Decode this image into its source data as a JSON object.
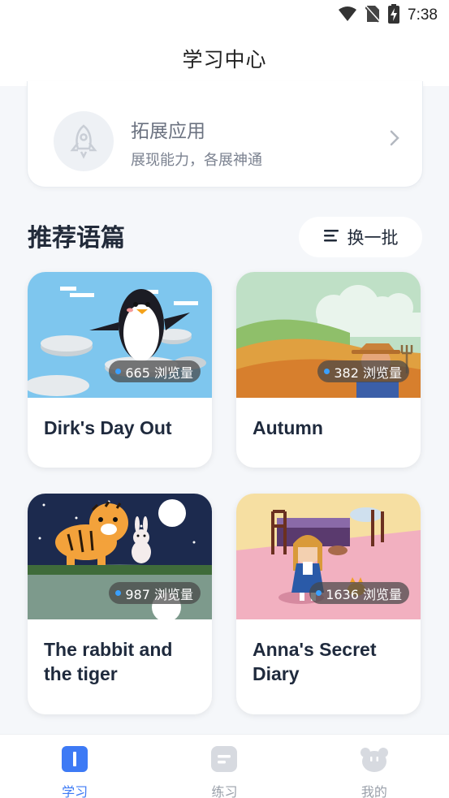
{
  "status_bar": {
    "time": "7:38"
  },
  "header": {
    "title": "学习中心"
  },
  "extension": {
    "title": "拓展应用",
    "subtitle": "展现能力，各展神通"
  },
  "section": {
    "title": "推荐语篇",
    "refresh_label": "换一批"
  },
  "stories": [
    {
      "title": "Dirk's Day Out",
      "views": "665 浏览量"
    },
    {
      "title": "Autumn",
      "views": "382 浏览量"
    },
    {
      "title": "The rabbit and the tiger",
      "views": "987 浏览量"
    },
    {
      "title": "Anna's Secret Diary",
      "views": "1636 浏览量"
    }
  ],
  "bottom_nav": [
    {
      "label": "学习",
      "active": true,
      "color": "#3d7af5"
    },
    {
      "label": "练习",
      "active": false,
      "color": "#9aa0aa"
    },
    {
      "label": "我的",
      "active": false,
      "color": "#9aa0aa"
    }
  ]
}
